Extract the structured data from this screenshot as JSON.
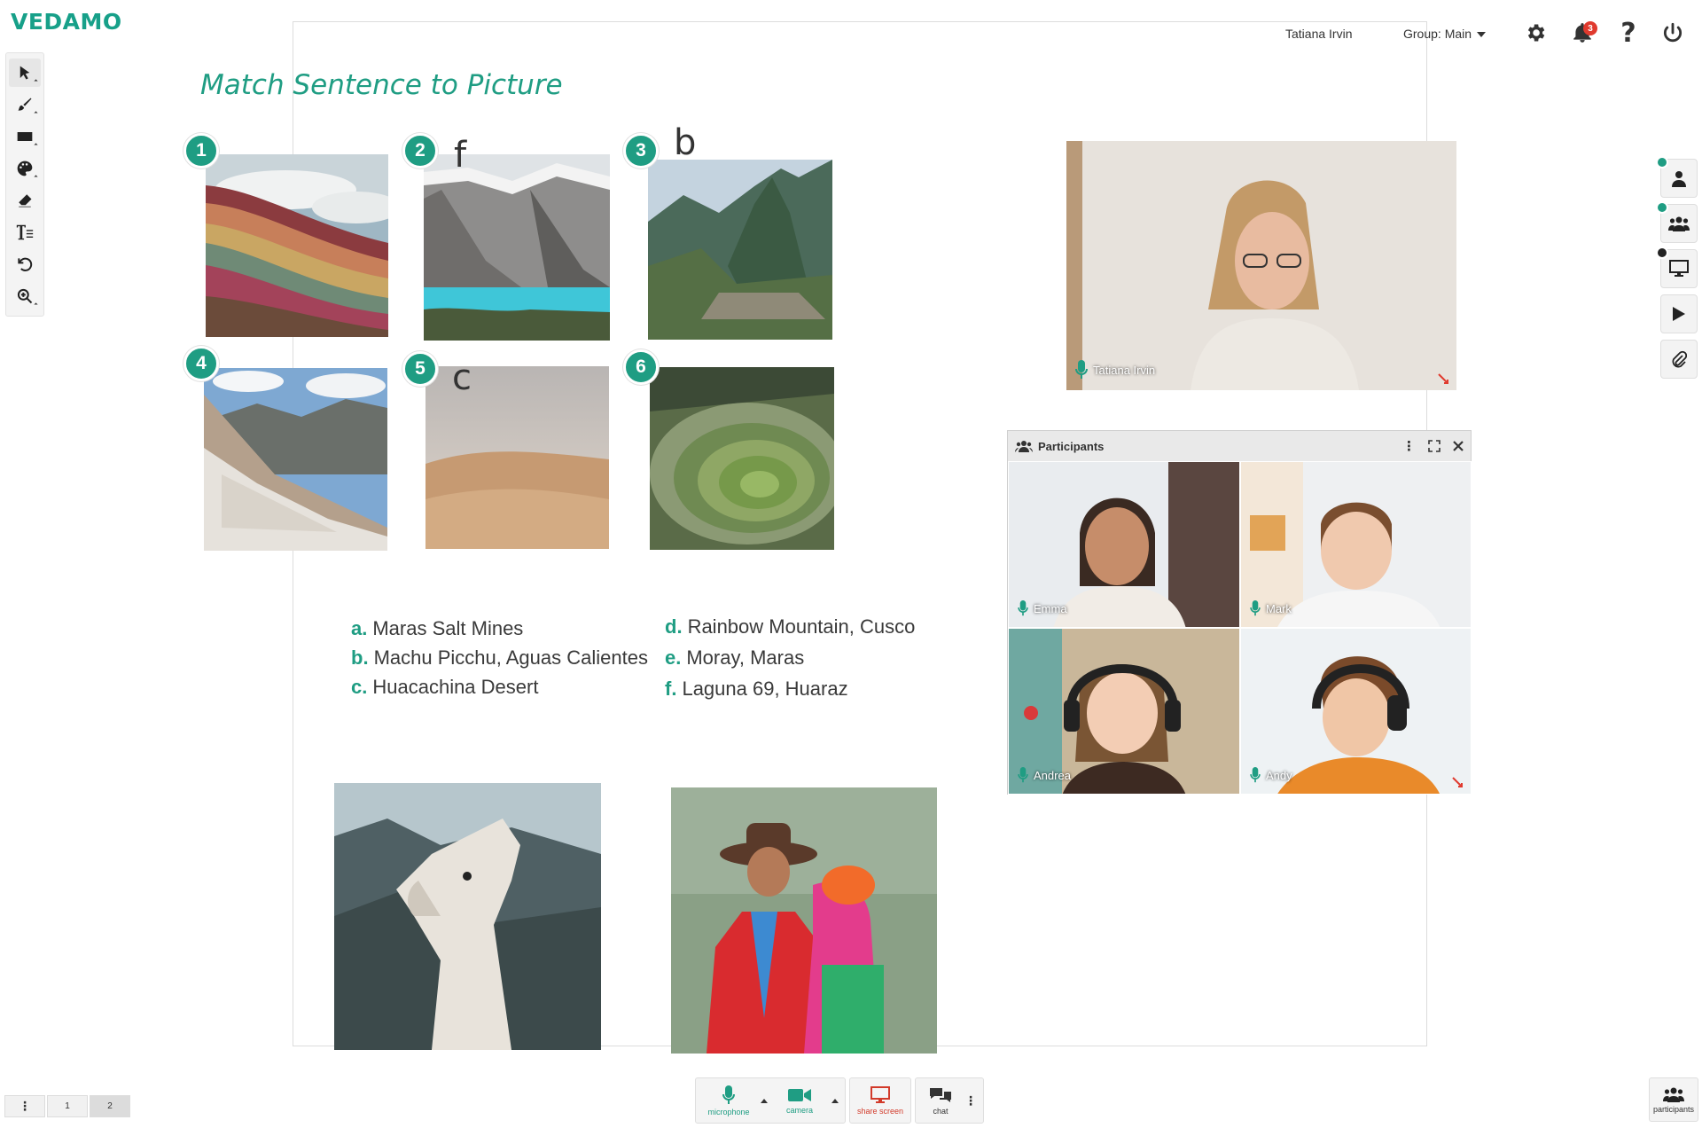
{
  "app": {
    "logo": "VEDAMO"
  },
  "topbar": {
    "user_name": "Tatiana Irvin",
    "group_label": "Group: Main",
    "notification_count": "3"
  },
  "slide": {
    "title": "Match Sentence to Picture",
    "pictures": [
      {
        "number": "1",
        "handwritten": ""
      },
      {
        "number": "2",
        "handwritten": "f"
      },
      {
        "number": "3",
        "handwritten": "b"
      },
      {
        "number": "4",
        "handwritten": ""
      },
      {
        "number": "5",
        "handwritten": "c"
      },
      {
        "number": "6",
        "handwritten": ""
      }
    ],
    "options": [
      {
        "letter": "a.",
        "text": "Maras Salt Mines"
      },
      {
        "letter": "b.",
        "text": "Machu Picchu, Aguas Calientes"
      },
      {
        "letter": "c.",
        "text": "Huacachina Desert"
      },
      {
        "letter": "d.",
        "text": "Rainbow Mountain, Cusco"
      },
      {
        "letter": "e.",
        "text": "Moray, Maras"
      },
      {
        "letter": "f.",
        "text": "Laguna 69, Huaraz"
      }
    ]
  },
  "teacher_video": {
    "name": "Tatiana Irvin"
  },
  "participants_panel": {
    "title": "Participants",
    "tiles": [
      {
        "name": "Emma"
      },
      {
        "name": "Mark"
      },
      {
        "name": "Andrea"
      },
      {
        "name": "Andy"
      }
    ]
  },
  "pages": {
    "more": "⋮",
    "items": [
      "1",
      "2"
    ],
    "current": "2"
  },
  "media": {
    "microphone": "microphone",
    "camera": "camera",
    "share_screen": "share screen",
    "chat": "chat"
  },
  "participants_button": {
    "label": "participants"
  },
  "colors": {
    "brand": "#17a089",
    "accent": "#1f9d83",
    "danger": "#e03a2e",
    "mic": "#1f9d83",
    "share": "#d23a2a"
  }
}
